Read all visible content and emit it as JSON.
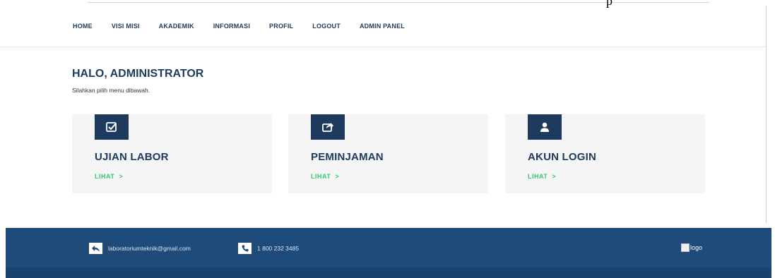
{
  "top_fragment": "p",
  "nav": {
    "items": [
      "HOME",
      "VISI MISI",
      "AKADEMIK",
      "INFORMASI",
      "PROFIL",
      "LOGOUT",
      "ADMIN PANEL"
    ]
  },
  "greeting": {
    "title": "HALO, ADMINISTRATOR",
    "subtitle": "Silahkan pilih menu dibawah."
  },
  "cards": [
    {
      "icon": "check-square-icon",
      "title": "UJIAN LABOR",
      "link": "LIHAT",
      "chevron": ">"
    },
    {
      "icon": "share-icon",
      "title": "PEMINJAMAN",
      "link": "LIHAT",
      "chevron": ">"
    },
    {
      "icon": "user-icon",
      "title": "AKUN LOGIN",
      "link": "LIHAT",
      "chevron": ">"
    }
  ],
  "footer": {
    "email": "laboratoriumteknik@gmail.com",
    "phone": "1 800 232 3485",
    "logo_alt": "logo"
  },
  "colors": {
    "brand": "#1e3a5f",
    "footer_bg": "#1e4b7a",
    "link_green": "#2ecc71",
    "card_bg": "#f5f5f5"
  }
}
